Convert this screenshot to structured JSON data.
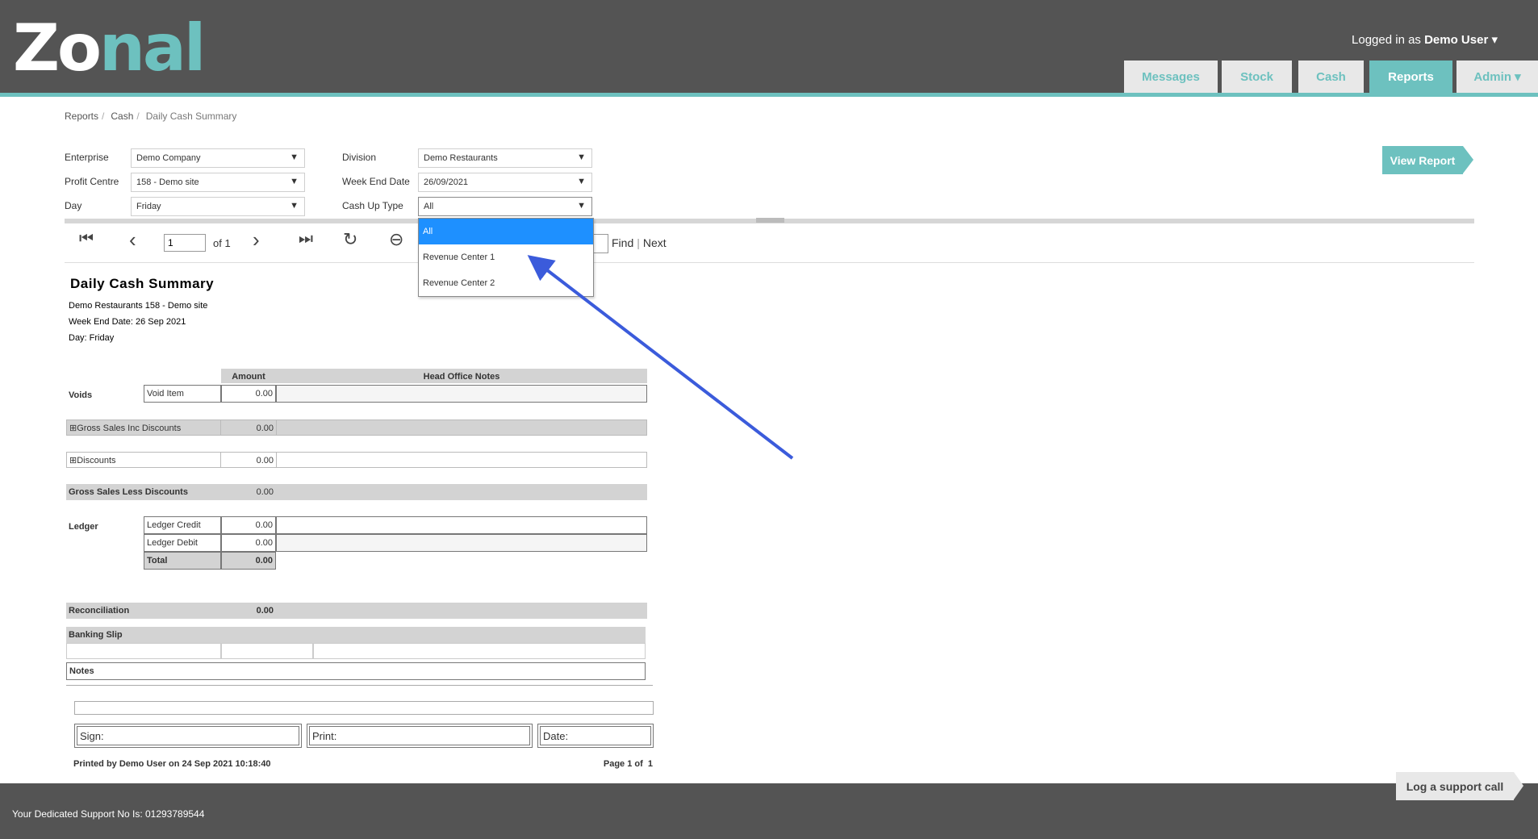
{
  "header": {
    "logo_part1": "Zo",
    "logo_part2": "nal",
    "logged_in_prefix": "Logged in as",
    "user": "Demo User",
    "user_caret": "▾",
    "nav": [
      "Messages",
      "Stock",
      "Cash",
      "Reports",
      "Admin ▾"
    ]
  },
  "breadcrumb": [
    "Reports",
    "/",
    "Cash",
    "/",
    "Daily Cash Summary"
  ],
  "filters": {
    "enterprise_label": "Enterprise",
    "enterprise_value": "Demo Company",
    "profit_centre_label": "Profit Centre",
    "profit_centre_value": "158 - Demo site",
    "day_label": "Day",
    "day_value": "Friday",
    "division_label": "Division",
    "division_value": "Demo Restaurants",
    "week_end_label": "Week End Date",
    "week_end_value": "26/09/2021",
    "cashup_label": "Cash Up Type",
    "cashup_value": "All",
    "caret": "▼"
  },
  "view_report": "View Report",
  "dropdown_options": [
    "All",
    "Revenue Center 1",
    "Revenue Center 2"
  ],
  "toolbar": {
    "page_value": "1",
    "of_pages": "of 1",
    "find": "Find",
    "sep": "|",
    "next": "Next",
    "icons": {
      "first": "⏮",
      "prev": "‹",
      "next": "›",
      "last": "⏭",
      "refresh": "↻",
      "back": "⊖"
    }
  },
  "report": {
    "title": "Daily Cash Summary",
    "line1": "Demo Restaurants 158 - Demo site",
    "line2": "Week End Date: 26 Sep 2021",
    "line3": "Day: Friday",
    "col_amount": "Amount",
    "col_notes": "Head Office Notes",
    "voids": "Voids",
    "void_item": "Void Item",
    "void_amount": "0.00",
    "gross_sales_inc": "Gross Sales Inc Discounts",
    "gross_sales_inc_amount": "0.00",
    "discounts": "Discounts",
    "discounts_amount": "0.00",
    "gross_less": "Gross Sales Less Discounts",
    "gross_less_amount": "0.00",
    "ledger": "Ledger",
    "ledger_credit": "Ledger Credit",
    "ledger_credit_amount": "0.00",
    "ledger_debit": "Ledger Debit",
    "ledger_debit_amount": "0.00",
    "total": "Total",
    "total_amount": "0.00",
    "reconciliation": "Reconciliation",
    "reconciliation_amount": "0.00",
    "banking_slip": "Banking Slip",
    "notes": "Notes",
    "sign": "Sign:",
    "print": "Print:",
    "date": "Date:",
    "printed_by": "Printed by Demo User on 24 Sep 2021 10:18:40",
    "page_of": "Page 1 of  1",
    "expand": "⊞"
  },
  "footer": {
    "support": "Your Dedicated Support No Is: 01293789544",
    "log_call": "Log a support call"
  },
  "colors": {
    "teal": "#6dc1bf",
    "header": "#545454",
    "selected": "#1e90ff",
    "arrow": "#3b5bdb"
  }
}
